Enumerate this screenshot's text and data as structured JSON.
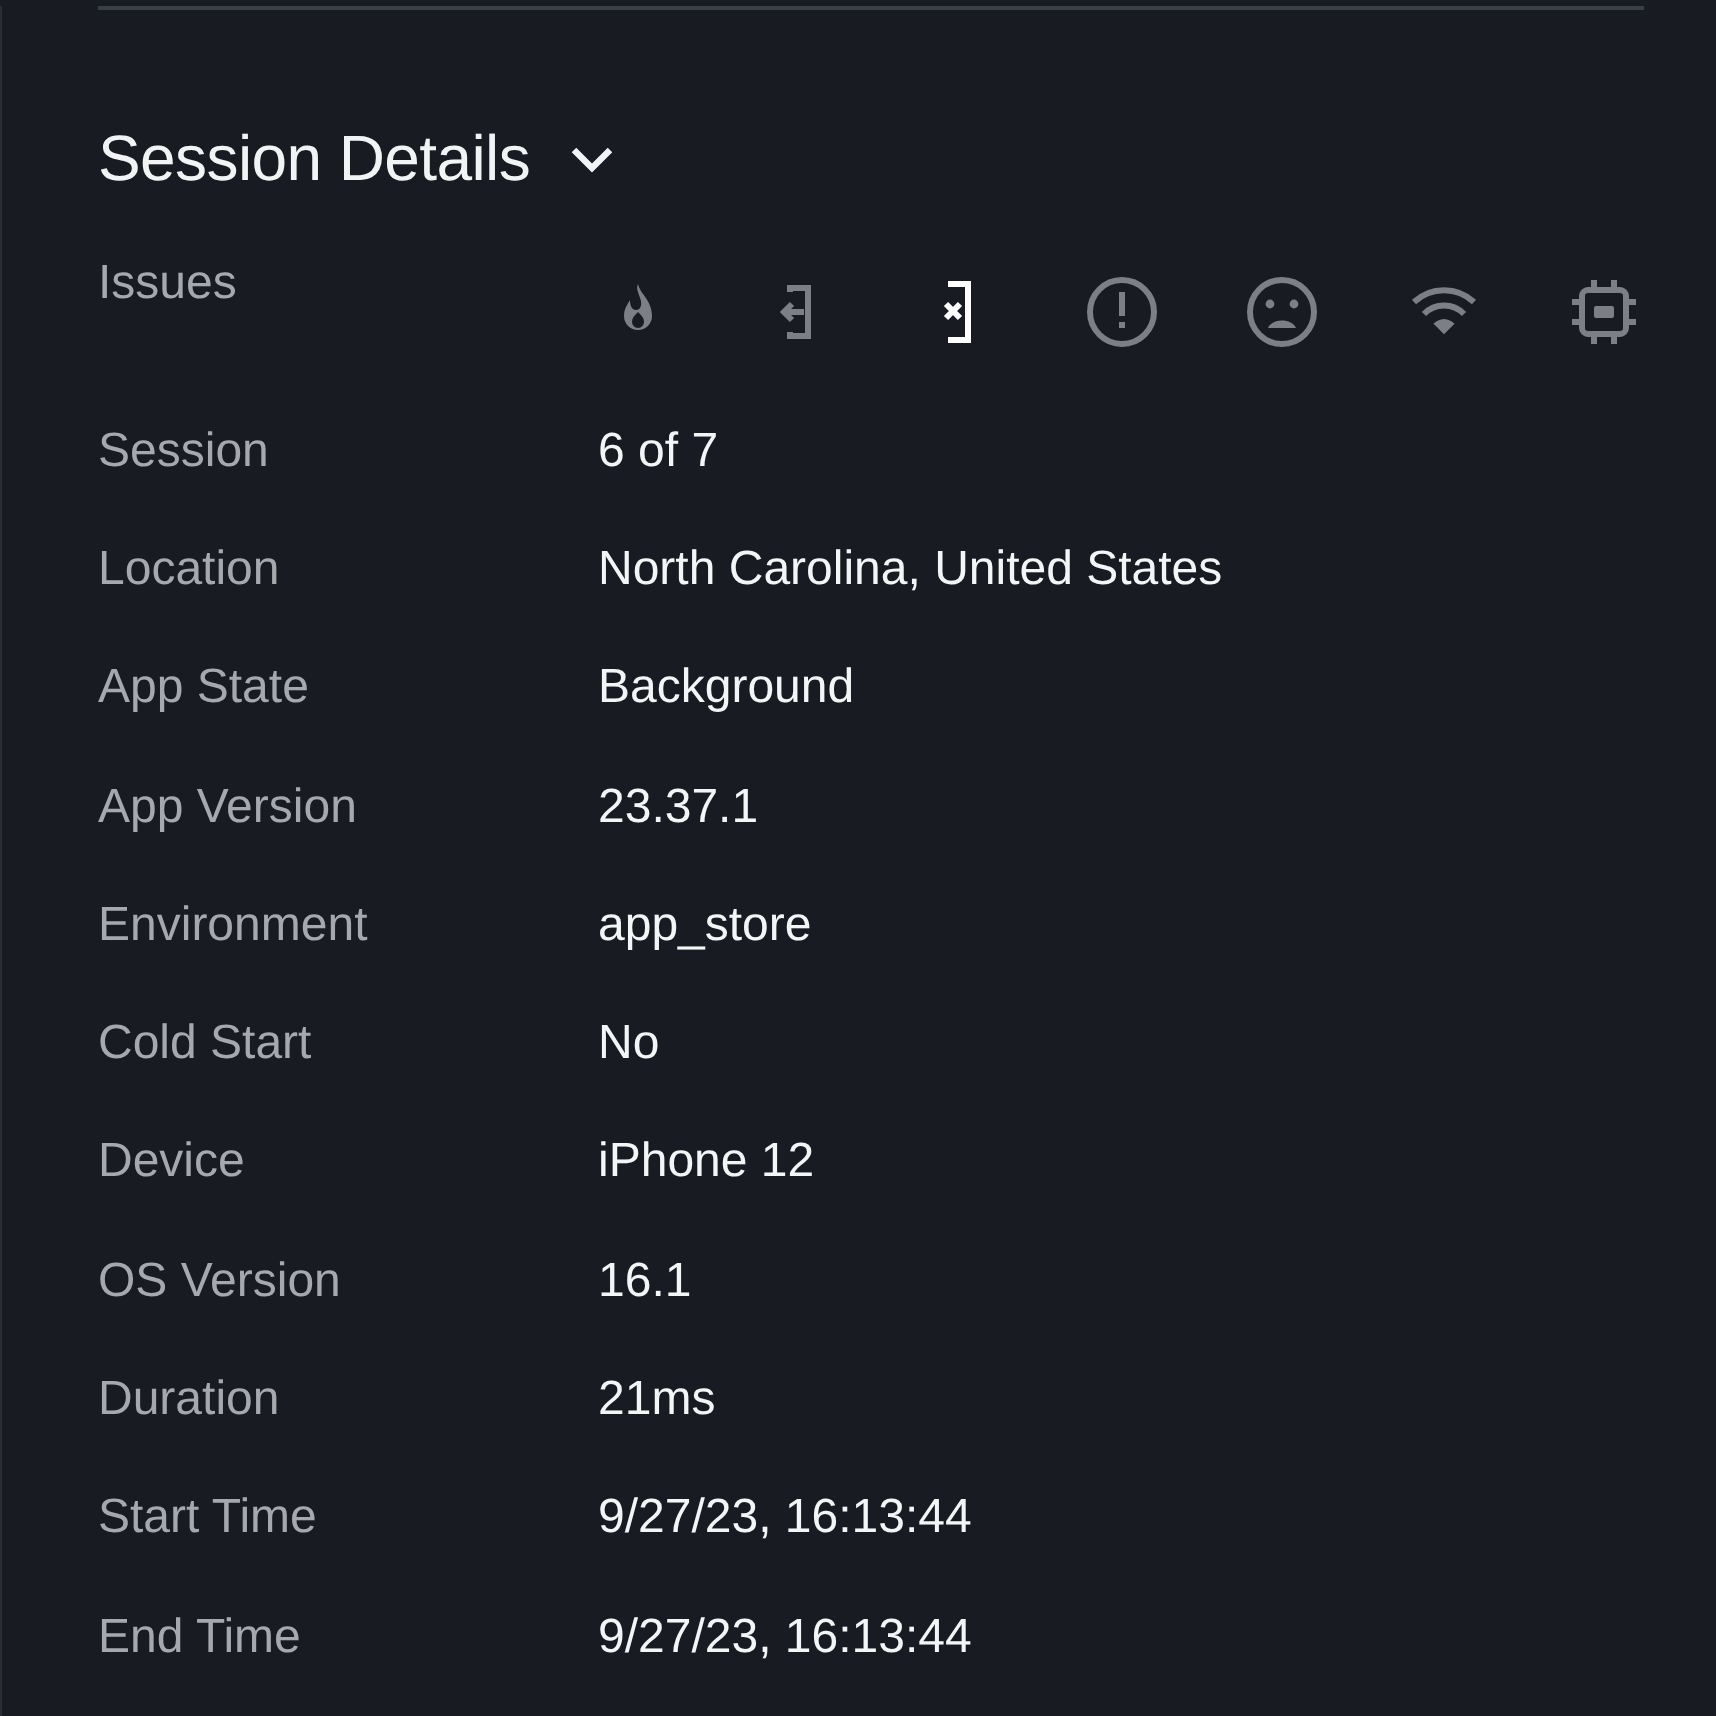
{
  "section": {
    "title": "Session Details",
    "expanded": true
  },
  "issues": {
    "label": "Issues",
    "items": [
      {
        "kind": "fire",
        "active": false
      },
      {
        "kind": "exit",
        "active": false
      },
      {
        "kind": "close-device",
        "active": true
      },
      {
        "kind": "alert",
        "active": false
      },
      {
        "kind": "sad",
        "active": false
      },
      {
        "kind": "wifi",
        "active": false
      },
      {
        "kind": "chip",
        "active": false
      }
    ]
  },
  "details": [
    {
      "label": "Session",
      "value": "6 of 7"
    },
    {
      "label": "Location",
      "value": "North Carolina, United States"
    },
    {
      "label": "App State",
      "value": "Background"
    },
    {
      "label": "App Version",
      "value": "23.37.1"
    },
    {
      "label": "Environment",
      "value": "app_store"
    },
    {
      "label": "Cold Start",
      "value": "No"
    },
    {
      "label": "Device",
      "value": "iPhone 12"
    },
    {
      "label": "OS Version",
      "value": "16.1"
    },
    {
      "label": "Duration",
      "value": "21ms"
    },
    {
      "label": "Start Time",
      "value": "9/27/23, 16:13:44"
    },
    {
      "label": "End Time",
      "value": "9/27/23, 16:13:44"
    }
  ]
}
